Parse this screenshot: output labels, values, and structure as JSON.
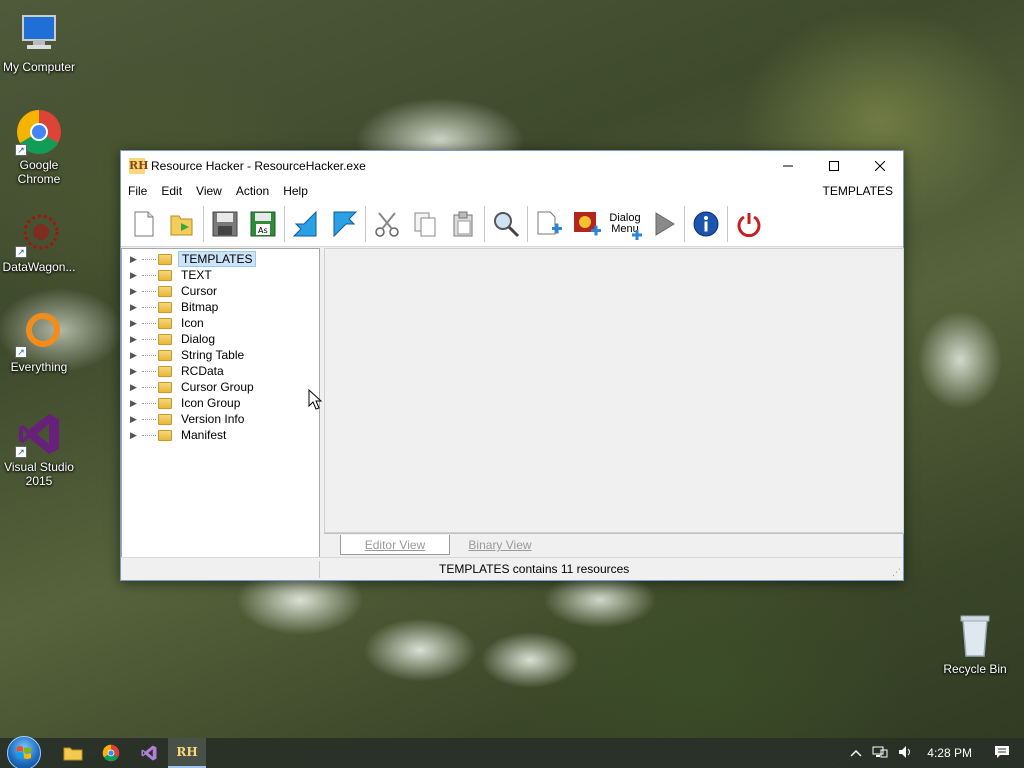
{
  "desktop": {
    "icons": [
      {
        "label": "My Computer"
      },
      {
        "label": "Google Chrome"
      },
      {
        "label": "DataWagon..."
      },
      {
        "label": "Everything"
      },
      {
        "label": "Visual Studio 2015"
      },
      {
        "label": "Recycle Bin"
      }
    ]
  },
  "window": {
    "title": "Resource Hacker - ResourceHacker.exe",
    "icon_text": "RH",
    "menu": [
      "File",
      "Edit",
      "View",
      "Action",
      "Help"
    ],
    "menu_right_label": "TEMPLATES",
    "toolbar": {
      "dialog_menu_label_1": "Dialog",
      "dialog_menu_label_2": "Menu"
    },
    "tree": [
      {
        "label": "TEMPLATES",
        "selected": true
      },
      {
        "label": "TEXT"
      },
      {
        "label": "Cursor"
      },
      {
        "label": "Bitmap"
      },
      {
        "label": "Icon"
      },
      {
        "label": "Dialog"
      },
      {
        "label": "String Table"
      },
      {
        "label": "RCData"
      },
      {
        "label": "Cursor Group"
      },
      {
        "label": "Icon Group"
      },
      {
        "label": "Version Info"
      },
      {
        "label": "Manifest"
      }
    ],
    "tabs": {
      "editor": "Editor View",
      "binary": "Binary View"
    },
    "status": "TEMPLATES contains 11 resources"
  },
  "taskbar": {
    "clock": "4:28 PM"
  }
}
